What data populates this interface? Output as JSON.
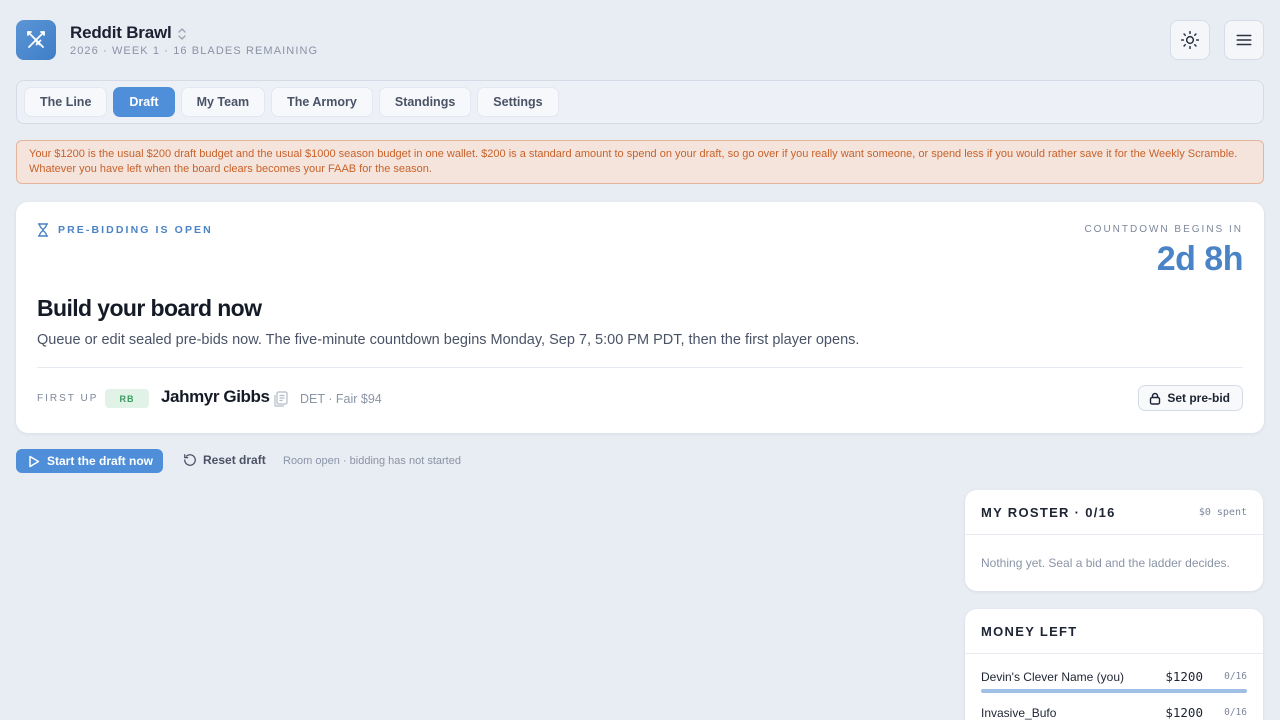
{
  "app": {
    "title": "Reddit Brawl",
    "subtitle": "2026 · WEEK 1 · 16 BLADES REMAINING",
    "accent": "#4f8fd9"
  },
  "tabs": [
    {
      "label": "The Line",
      "active": false
    },
    {
      "label": "Draft",
      "active": true
    },
    {
      "label": "My Team",
      "active": false
    },
    {
      "label": "The Armory",
      "active": false
    },
    {
      "label": "Standings",
      "active": false
    },
    {
      "label": "Settings",
      "active": false
    }
  ],
  "notice": {
    "text": "Your $1200 is the usual $200 draft budget and the usual $1000 season budget in one wallet. $200 is a standard amount to spend on your draft, so go over if you really want someone, or spend less if you would rather save it for the Weekly Scramble. Whatever you have left when the board clears becomes your FAAB for the season."
  },
  "draft_card": {
    "status_label": "PRE-BIDDING IS OPEN",
    "countdown_label": "COUNTDOWN BEGINS IN",
    "countdown_value": "2d 8h",
    "title": "Build your board now",
    "description": "Queue or edit sealed pre-bids now. The five-minute countdown begins Monday, Sep 7, 5:00 PM PDT, then the first player opens.",
    "first_up_label": "FIRST UP",
    "player": {
      "position": "RB",
      "name": "Jahmyr Gibbs",
      "meta": "DET · Fair $94"
    },
    "set_prebid_label": "Set pre-bid"
  },
  "actions": {
    "start_label": "Start the draft now",
    "reset_label": "Reset draft",
    "status": "Room open · bidding has not started"
  },
  "roster": {
    "title": "MY ROSTER · 0/16",
    "spent": "$0 spent",
    "empty_text": "Nothing yet. Seal a bid and the ladder decides."
  },
  "money": {
    "title": "MONEY LEFT",
    "rows": [
      {
        "name": "Devin's Clever Name (you)",
        "amount": "$1200",
        "count": "0/16",
        "fill": 1.0
      },
      {
        "name": "Invasive_Bufo",
        "amount": "$1200",
        "count": "0/16",
        "fill": 1.0
      }
    ]
  },
  "icons": {
    "logo": "crossed-swords-icon",
    "theme": "sun-icon",
    "menu": "hamburger-menu-icon",
    "status": "hourglass-icon",
    "player_doc": "document-icon",
    "lock": "lock-icon",
    "play": "play-icon",
    "reset": "rotate-ccw-icon"
  }
}
